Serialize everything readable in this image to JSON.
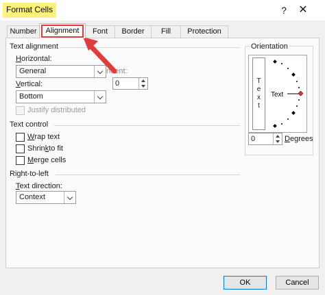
{
  "dialog": {
    "title": "Format Cells",
    "help_glyph": "?",
    "close_glyph": "✕"
  },
  "tabs": [
    {
      "label": "Number"
    },
    {
      "label": "Alignment",
      "active": true
    },
    {
      "label": "Font"
    },
    {
      "label": "Border"
    },
    {
      "label": "Fill"
    },
    {
      "label": "Protection"
    }
  ],
  "text_alignment": {
    "section": "Text alignment",
    "horizontal_label_u": "H",
    "horizontal_label_rest": "orizontal:",
    "horizontal_value": "General",
    "vertical_label_u": "V",
    "vertical_label_rest": "ertical:",
    "vertical_value": "Bottom",
    "indent_label": "ndent:",
    "indent_value": "0",
    "justify_distributed": "Justify distributed"
  },
  "text_control": {
    "section": "Text control",
    "wrap_u": "W",
    "wrap_rest": "rap text",
    "shrink_pre": "Shrin",
    "shrink_u": "k",
    "shrink_rest": " to fit",
    "merge_u": "M",
    "merge_rest": "erge cells"
  },
  "rtl": {
    "section": "Right-to-left",
    "direction_label_u": "T",
    "direction_label_rest": "ext direction:",
    "direction_value": "Context"
  },
  "orientation": {
    "section": "Orientation",
    "vertical_text": [
      "T",
      "e",
      "x",
      "t"
    ],
    "dial_text": "Text",
    "degrees_value": "0",
    "degrees_label_u": "D",
    "degrees_label_rest": "egrees"
  },
  "buttons": {
    "ok": "OK",
    "cancel": "Cancel"
  },
  "colors": {
    "highlight": "#fff27a",
    "annotation_red": "#e33a3a",
    "accent_blue": "#0078d7"
  }
}
